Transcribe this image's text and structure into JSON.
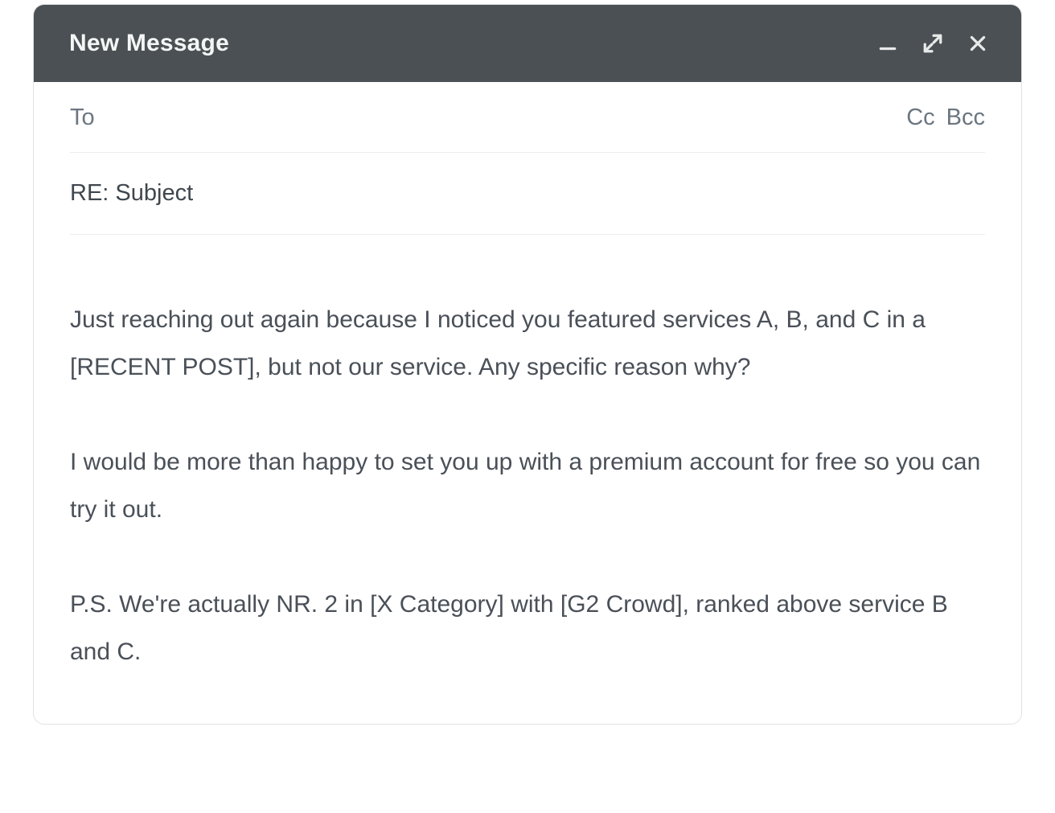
{
  "header": {
    "title": "New Message"
  },
  "fields": {
    "to_label": "To",
    "cc_label": "Cc",
    "bcc_label": "Bcc",
    "subject": "RE: Subject"
  },
  "body": {
    "p1": "Just reaching out again because I noticed you featured services A, B, and C in a [RECENT POST], but not our service. Any specific reason why?",
    "p2": "I would be more than happy to set you up with a premium account for free so you can try it out.",
    "p3": "P.S. We're actually NR. 2 in [X Category] with [G2 Crowd], ranked above service B and C."
  }
}
